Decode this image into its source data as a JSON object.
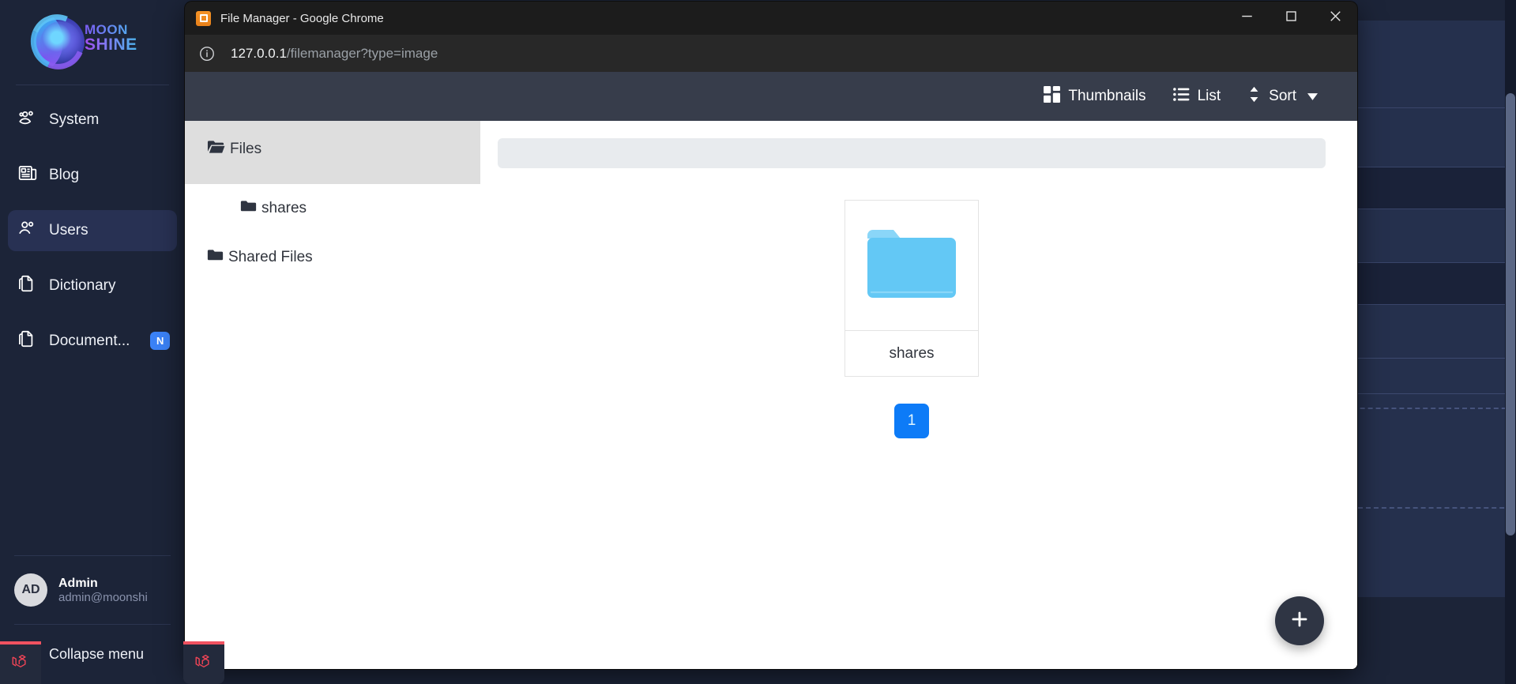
{
  "desktop": {
    "taskbar": {
      "items": [
        {
          "icon": "laravel-icon"
        },
        {
          "icon": "laravel-icon"
        }
      ]
    }
  },
  "admin_app": {
    "logo": {
      "line1": "MOON",
      "line2": "SHINE",
      "icon": "moonshine-logo-icon"
    },
    "sidebar": {
      "items": [
        {
          "label": "System",
          "icon": "users-group-icon",
          "active": false
        },
        {
          "label": "Blog",
          "icon": "newspaper-icon",
          "active": false
        },
        {
          "label": "Users",
          "icon": "user-pair-icon",
          "active": true
        },
        {
          "label": "Dictionary",
          "icon": "documents-icon",
          "active": false
        },
        {
          "label": "Document...",
          "icon": "documents-icon",
          "active": false,
          "badge": "N"
        }
      ],
      "user": {
        "initials": "AD",
        "name": "Admin",
        "email": "admin@moonshi"
      },
      "collapse_label": "Collapse menu",
      "collapse_icon": "arrow-left-circle-icon"
    },
    "colors": {
      "sidebar_bg": "#1c2438",
      "active_item": "#283153",
      "badge": "#3b82f6"
    }
  },
  "browser": {
    "window_title": "File Manager - Google Chrome",
    "favicon": "file-manager-favicon",
    "url_host": "127.0.0.1",
    "url_path": "/filemanager?type=image",
    "site_info_icon": "info-circle-icon",
    "controls": {
      "minimize": {
        "icon": "minimize-icon",
        "label": "Minimize"
      },
      "maximize": {
        "icon": "maximize-icon",
        "label": "Maximize"
      },
      "close": {
        "icon": "close-icon",
        "label": "Close"
      }
    }
  },
  "file_manager": {
    "toolbar": {
      "thumbnails": {
        "label": "Thumbnails",
        "icon": "grid-view-icon"
      },
      "list": {
        "label": "List",
        "icon": "list-view-icon"
      },
      "sort": {
        "label": "Sort",
        "icon": "sort-icon",
        "caret": "chevron-down-icon"
      }
    },
    "tree": [
      {
        "label": "Files",
        "icon": "folder-open-icon",
        "level": 0,
        "selected": true
      },
      {
        "label": "shares",
        "icon": "folder-closed-icon",
        "level": 1,
        "selected": false
      },
      {
        "label": "Shared Files",
        "icon": "folder-closed-icon",
        "level": 0,
        "selected": false
      }
    ],
    "breadcrumb": "",
    "items": [
      {
        "name": "shares",
        "type": "folder",
        "icon": "folder-blue-icon"
      }
    ],
    "pagination": {
      "current": "1",
      "pages": [
        "1"
      ]
    },
    "add_button": {
      "icon": "plus-icon",
      "label": "Add"
    },
    "colors": {
      "toolbar_bg": "#373d4b",
      "tree_selected_bg": "#dedede",
      "folder": "#63c8f5",
      "pager_active": "#0d7bf7"
    }
  }
}
